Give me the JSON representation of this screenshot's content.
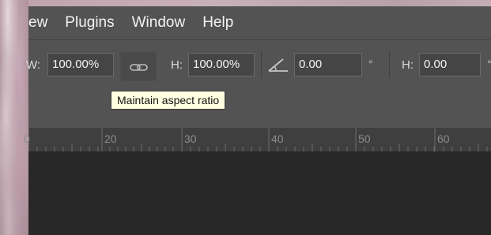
{
  "menu": {
    "view": "ew",
    "plugins": "Plugins",
    "window": "Window",
    "help": "Help"
  },
  "options": {
    "width_label": "W:",
    "width_value": "100.00%",
    "height_label": "H:",
    "height_value": "100.00%",
    "angle_value": "0.00",
    "degree_symbol": "°",
    "skew_label": "H:",
    "skew_value": "0.00",
    "link_icon": "chain-link-icon",
    "angle_icon": "angle-icon"
  },
  "tooltip": "Maintain aspect ratio",
  "ruler": {
    "labels": [
      "0",
      "20",
      "30",
      "40",
      "50",
      "60"
    ]
  },
  "colors": {
    "panel": "#535353",
    "field": "#454545",
    "ruler": "#3f3f3f",
    "canvas": "#282828",
    "tooltip": "#ffffe1"
  }
}
